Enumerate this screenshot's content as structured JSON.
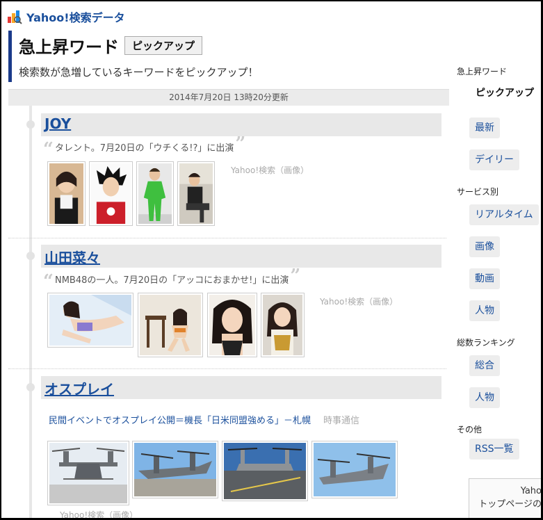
{
  "header": {
    "logo_text": "Yahoo!検索データ"
  },
  "title": {
    "main": "急上昇ワード",
    "badge": "ピックアップ",
    "subtitle": "検索数が急増しているキーワードをピックアップ！"
  },
  "update_time": "2014年7月20日 13時20分更新",
  "entries": [
    {
      "keyword": "JOY",
      "description": "タレント。7月20日の「ウチくる!?」に出演",
      "image_source": "Yahoo!検索（画像）"
    },
    {
      "keyword": "山田菜々",
      "description": "NMB48の一人。7月20日の「アッコにおまかせ!」に出演",
      "image_source": "Yahoo!検索（画像）"
    },
    {
      "keyword": "オスプレイ",
      "news_headline": "民間イベントでオスプレイ公開＝機長「日米同盟強める」－札幌",
      "news_source": "時事通信",
      "image_source": "Yahoo!検索（画像）"
    }
  ],
  "quote_open": "“",
  "quote_close": "”",
  "sidebar": {
    "group1_title": "急上昇ワード",
    "active_item": "ピックアップ",
    "latest": "最新",
    "daily": "デイリー",
    "group2_title": "サービス別",
    "realtime": "リアルタイム",
    "image": "画像",
    "video": "動画",
    "person": "人物",
    "group3_title": "総数ランキング",
    "overall": "総合",
    "person2": "人物",
    "group4_title": "その他",
    "rss": "RSS一覧"
  },
  "promo": {
    "line1": "Yaho",
    "line2": "トップページの"
  },
  "colors": {
    "link": "#1a4f9c",
    "accent_bar": "#1a3a8a"
  }
}
